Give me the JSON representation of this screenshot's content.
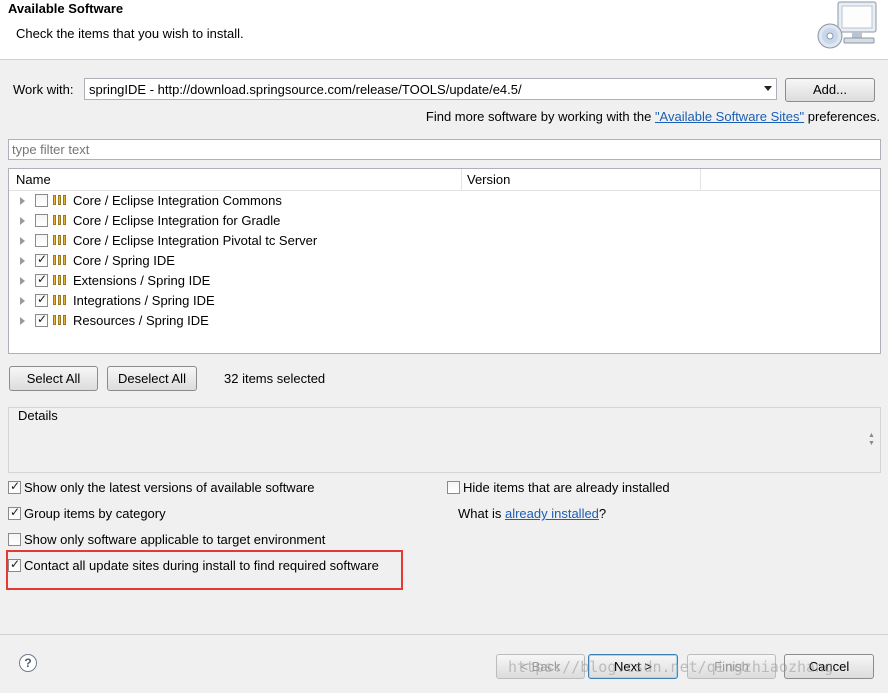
{
  "header": {
    "title": "Available Software",
    "subtitle": "Check the items that you wish to install.",
    "icon": "install-monitor-cd-icon"
  },
  "work_with": {
    "label": "Work with:",
    "value": "springIDE - http://download.springsource.com/release/TOOLS/update/e4.5/",
    "add_label": "Add..."
  },
  "find_more": {
    "prefix": "Find more software by working with the ",
    "link": "\"Available Software Sites\"",
    "suffix": " preferences."
  },
  "filter": {
    "placeholder": "type filter text"
  },
  "tree": {
    "columns": [
      "Name",
      "Version",
      ""
    ],
    "rows": [
      {
        "label": "Core / Eclipse Integration Commons",
        "checked": false
      },
      {
        "label": "Core / Eclipse Integration for Gradle",
        "checked": false
      },
      {
        "label": "Core / Eclipse Integration Pivotal tc Server",
        "checked": false
      },
      {
        "label": "Core / Spring IDE",
        "checked": true
      },
      {
        "label": "Extensions / Spring IDE",
        "checked": true
      },
      {
        "label": "Integrations / Spring IDE",
        "checked": true
      },
      {
        "label": "Resources / Spring IDE",
        "checked": true
      }
    ]
  },
  "selection": {
    "select_all": "Select All",
    "deselect_all": "Deselect All",
    "count_text": "32 items selected"
  },
  "details": {
    "title": "Details",
    "text": ""
  },
  "options": {
    "show_latest": {
      "label": "Show only the latest versions of available software",
      "checked": true
    },
    "group_by_category": {
      "label": "Group items by category",
      "checked": true
    },
    "show_applicable": {
      "label": "Show only software applicable to target environment",
      "checked": false
    },
    "contact_update_sites": {
      "label": "Contact all update sites during install to find required software",
      "checked": true
    },
    "hide_installed": {
      "label": "Hide items that are already installed",
      "checked": false
    }
  },
  "what_is": {
    "prefix": "What is ",
    "link": "already installed",
    "suffix": "?"
  },
  "buttons": {
    "help": "?",
    "back": "< Back",
    "next": "Next >",
    "finish": "Finish",
    "cancel": "Cancel"
  },
  "watermark": "https://blog.csdn.net/qingzhiaozhang",
  "colors": {
    "highlight": "#e53935",
    "link": "#1a5fb4"
  }
}
